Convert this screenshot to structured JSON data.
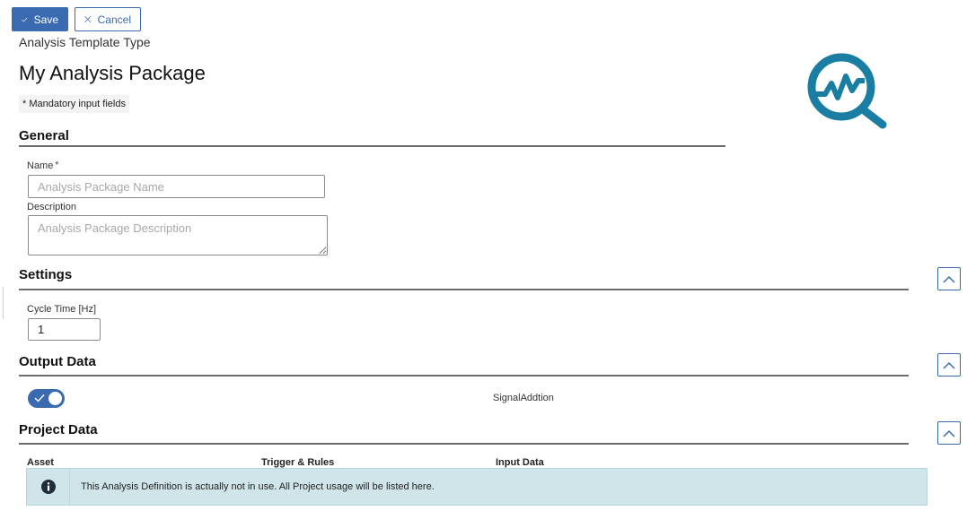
{
  "toolbar": {
    "save_label": "Save",
    "cancel_label": "Cancel"
  },
  "header": {
    "subtitle": "Analysis Template Type",
    "title": "My Analysis Package",
    "mandatory_note": "* Mandatory input fields"
  },
  "sections": {
    "general": {
      "title": "General",
      "name_label": "Name",
      "name_required_mark": "*",
      "name_placeholder": "Analysis Package Name",
      "name_value": "",
      "description_label": "Description",
      "description_placeholder": "Analysis Package Description",
      "description_value": ""
    },
    "settings": {
      "title": "Settings",
      "cycle_time_label": "Cycle Time [Hz]",
      "cycle_time_value": "1"
    },
    "output_data": {
      "title": "Output Data",
      "toggle_on": true,
      "signal_label": "SignalAddtion"
    },
    "project_data": {
      "title": "Project Data",
      "columns": [
        "Asset",
        "Trigger & Rules",
        "Input Data"
      ],
      "info_message": "This Analysis Definition is actually not in use. All Project usage will be listed here."
    }
  },
  "icons": {
    "logo": "analysis-magnifier-logo",
    "collapse": "chevron-up-icon",
    "info": "info-circle-icon"
  },
  "colors": {
    "accent": "#3a6ab0",
    "logo": "#1a7ea3",
    "info_bg": "#cfe5ea"
  }
}
